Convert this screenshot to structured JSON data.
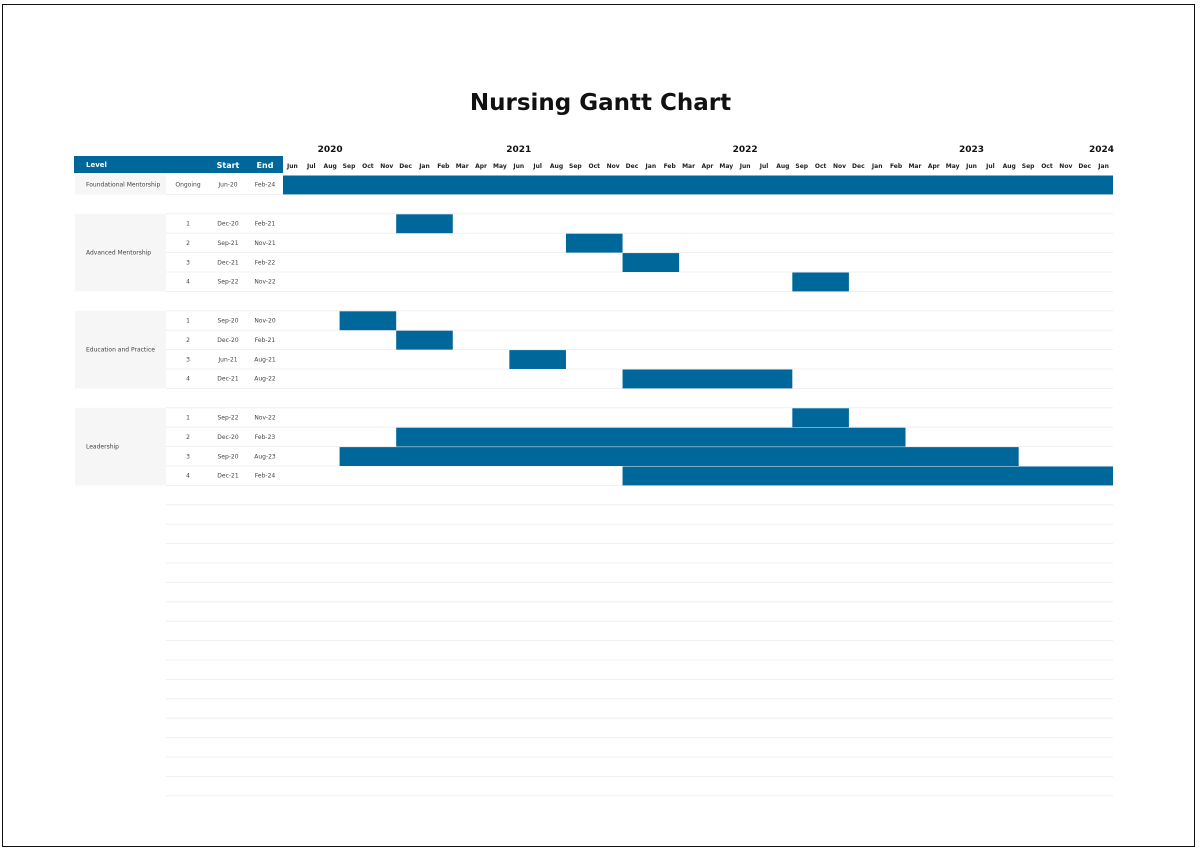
{
  "title": "Nursing Gantt Chart",
  "colors": {
    "bar": "#00679a",
    "header": "#00679a",
    "header_text": "#ffffff",
    "label_bg": "#f6f6f6",
    "grid": "#ececec"
  },
  "header": {
    "level": "Level",
    "start": "Start",
    "end": "End"
  },
  "chart_data": {
    "type": "gantt",
    "title": "Nursing Gantt Chart",
    "years": [
      "2020",
      "2021",
      "2022",
      "2023",
      "2024"
    ],
    "months": [
      "Jun",
      "Jul",
      "Aug",
      "Sep",
      "Oct",
      "Nov",
      "Dec",
      "Jan",
      "Feb",
      "Mar",
      "Apr",
      "May",
      "Jun",
      "Jul",
      "Aug",
      "Sep",
      "Oct",
      "Nov",
      "Dec",
      "Jan",
      "Feb",
      "Mar",
      "Apr",
      "May",
      "Jun",
      "Jul",
      "Aug",
      "Sep",
      "Oct",
      "Nov",
      "Dec",
      "Jan",
      "Feb",
      "Mar",
      "Apr",
      "May",
      "Jun",
      "Jul",
      "Aug",
      "Sep",
      "Oct",
      "Nov",
      "Dec",
      "Jan"
    ],
    "timeline_start": "2020-06",
    "timeline_end": "2024-01",
    "groups": [
      {
        "level": "Foundational Mentorship",
        "tasks": [
          {
            "id": "Ongoing",
            "start": "Jun-20",
            "end": "Feb-24"
          }
        ]
      },
      {
        "level": "Advanced Mentorship",
        "tasks": [
          {
            "id": "1",
            "start": "Dec-20",
            "end": "Feb-21"
          },
          {
            "id": "2",
            "start": "Sep-21",
            "end": "Nov-21"
          },
          {
            "id": "3",
            "start": "Dec-21",
            "end": "Feb-22"
          },
          {
            "id": "4",
            "start": "Sep-22",
            "end": "Nov-22"
          }
        ]
      },
      {
        "level": "Education and Practice",
        "tasks": [
          {
            "id": "1",
            "start": "Sep-20",
            "end": "Nov-20"
          },
          {
            "id": "2",
            "start": "Dec-20",
            "end": "Feb-21"
          },
          {
            "id": "3",
            "start": "Jun-21",
            "end": "Aug-21"
          },
          {
            "id": "4",
            "start": "Dec-21",
            "end": "Aug-22"
          }
        ]
      },
      {
        "level": "Leadership",
        "tasks": [
          {
            "id": "1",
            "start": "Sep-22",
            "end": "Nov-22"
          },
          {
            "id": "2",
            "start": "Dec-20",
            "end": "Feb-23"
          },
          {
            "id": "3",
            "start": "Sep-20",
            "end": "Aug-23"
          },
          {
            "id": "4",
            "start": "Dec-21",
            "end": "Feb-24"
          }
        ]
      }
    ]
  }
}
